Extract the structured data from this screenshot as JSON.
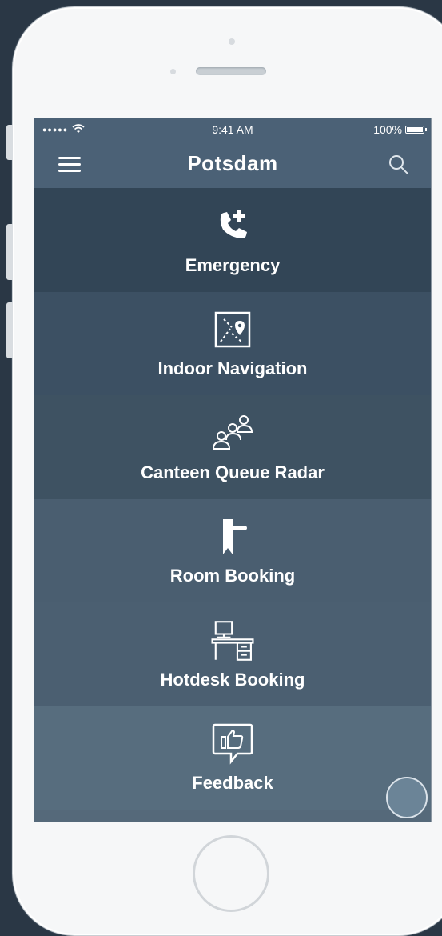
{
  "status_bar": {
    "signal": "●●●●●",
    "time": "9:41 AM",
    "battery": "100%",
    "battery_level": 1.0
  },
  "header": {
    "title": "Potsdam",
    "menu_icon": "hamburger-menu-icon",
    "search_icon": "search-icon"
  },
  "tiles": [
    {
      "label": "Emergency",
      "icon": "phone-plus-icon",
      "color": "#324556"
    },
    {
      "label": "Indoor Navigation",
      "icon": "map-pin-icon",
      "color": "#3c5063"
    },
    {
      "label": "Canteen Queue Radar",
      "icon": "people-queue-icon",
      "color": "#3e5262"
    },
    {
      "label": "Room Booking",
      "icon": "door-handle-icon",
      "color": "#4a5e70"
    },
    {
      "label": "Hotdesk Booking",
      "icon": "desk-monitor-icon",
      "color": "#4b5f71"
    },
    {
      "label": "Feedback",
      "icon": "thumbs-up-bubble-icon",
      "color": "#576d7e"
    }
  ],
  "colors": {
    "nav_background": "#4b6176",
    "background": "#2a3745",
    "phone_frame": "#f6f7f8"
  }
}
